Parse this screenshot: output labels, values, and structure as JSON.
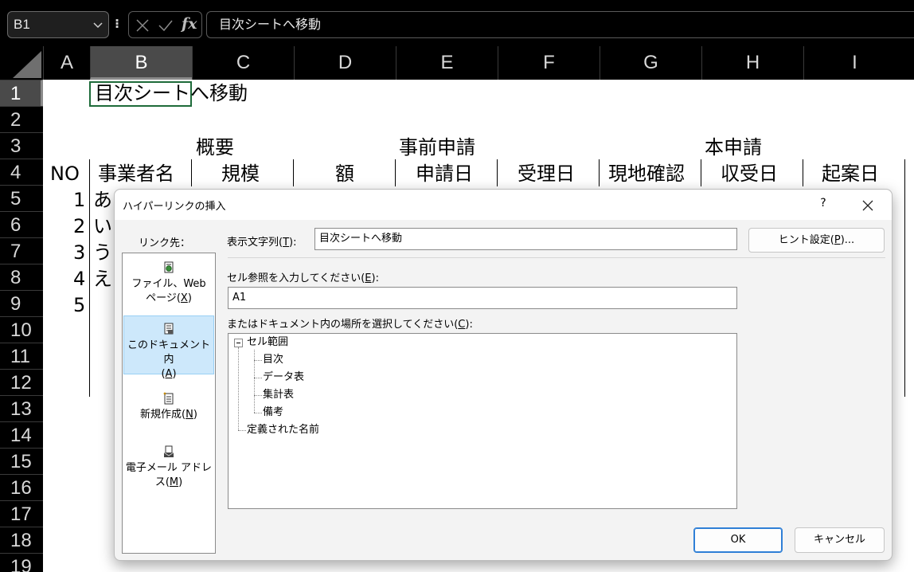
{
  "formula_bar": {
    "name_box": "B1",
    "formula": "目次シートへ移動",
    "fx_label": "fx"
  },
  "columns": [
    "A",
    "B",
    "C",
    "D",
    "E",
    "F",
    "G",
    "H",
    "I"
  ],
  "rows": [
    "1",
    "2",
    "3",
    "4",
    "5",
    "6",
    "7",
    "8",
    "9",
    "10",
    "11",
    "12",
    "13",
    "14",
    "15",
    "16",
    "17",
    "18",
    "19"
  ],
  "sheet": {
    "b1": "目次シートへ移動",
    "group_overview": "概要",
    "group_pre_application": "事前申請",
    "group_main_application": "本申請",
    "headers": [
      "NO",
      "事業者名",
      "規模",
      "額",
      "申請日",
      "受理日",
      "現地確認",
      "収受日",
      "起案日"
    ],
    "no_values": [
      "1",
      "2",
      "3",
      "4",
      "5"
    ],
    "names": [
      "あ",
      "い",
      "う",
      "え"
    ]
  },
  "dialog": {
    "title": "ハイパーリンクの挿入",
    "help": "?",
    "link_to_label": "リンク先：",
    "link_to_items": [
      {
        "label_a": "ファイル、Web",
        "label_b": "ページ(",
        "key": "X",
        "label_c": ")",
        "icon": "web-page-icon"
      },
      {
        "label_a": "このドキュメント内",
        "label_b": "(",
        "key": "A",
        "label_c": ")",
        "icon": "document-icon"
      },
      {
        "label_a": "",
        "label_b": "新規作成(",
        "key": "N",
        "label_c": ")",
        "icon": "new-document-icon"
      },
      {
        "label_a": "電子メール アドレ",
        "label_b": "ス(",
        "key": "M",
        "label_c": ")",
        "icon": "email-icon"
      }
    ],
    "display_text_label": "表示文字列(",
    "display_text_key": "T",
    "display_text_label_end": "):",
    "display_text_value": "目次シートへ移動",
    "hint_button": "ヒント設定(",
    "hint_button_key": "P",
    "hint_button_end": ")...",
    "cell_ref_label": "セル参照を入力してください(",
    "cell_ref_key": "E",
    "cell_ref_label_end": "):",
    "cell_ref_value": "A1",
    "place_label": "またはドキュメント内の場所を選択してください(",
    "place_key": "C",
    "place_label_end": "):",
    "tree": {
      "root": "セル範囲",
      "children": [
        "目次",
        "データ表",
        "集計表",
        "備考"
      ],
      "defined_names": "定義された名前"
    },
    "ok_button": "OK",
    "cancel_button": "キャンセル"
  }
}
